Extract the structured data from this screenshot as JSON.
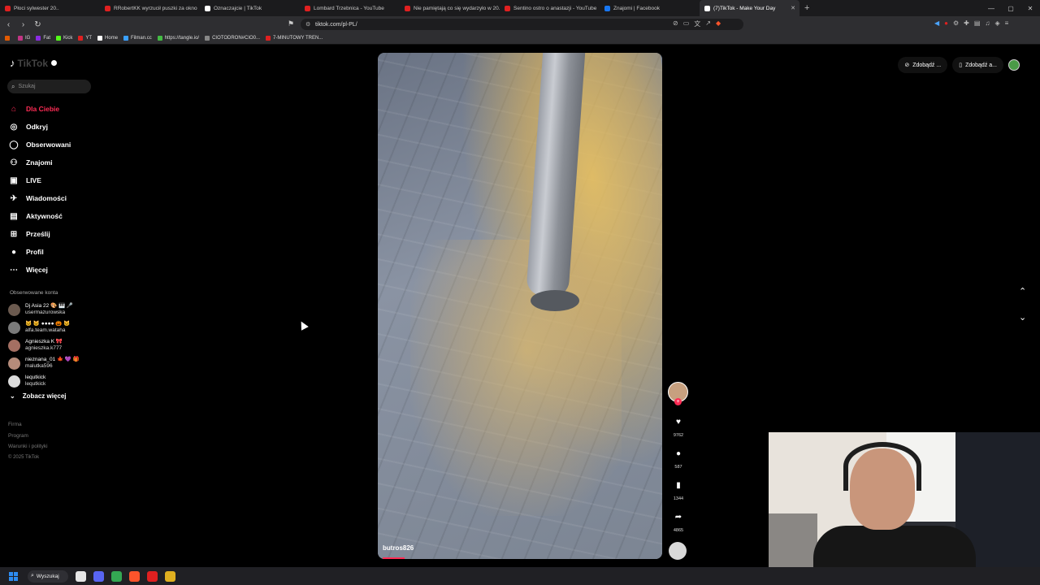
{
  "browser": {
    "tabs": [
      {
        "title": "Płoci sylwester 20..",
        "favicon_color": "#e02020",
        "active": false
      },
      {
        "title": "RRobertKK wyrzucił puszki za okno",
        "favicon_color": "#e02020",
        "active": false
      },
      {
        "title": "Oznaczajcie | TikTok",
        "favicon_color": "#ffffff",
        "active": false
      },
      {
        "title": "Lombard Trzebnica - YouTube",
        "favicon_color": "#e02020",
        "active": false
      },
      {
        "title": "Nie pamiętają co się wydarzyło w 20..",
        "favicon_color": "#e02020",
        "active": false
      },
      {
        "title": "Sentino ostro o anastazji - YouTube",
        "favicon_color": "#e02020",
        "active": false
      },
      {
        "title": "Znajomi | Facebook",
        "favicon_color": "#1877f2",
        "active": false
      },
      {
        "title": "(7)TikTok - Make Your Day",
        "favicon_color": "#ffffff",
        "active": true
      }
    ],
    "close_glyph": "✕",
    "new_tab_glyph": "+",
    "window_controls": [
      "—",
      "▢",
      "✕"
    ],
    "nav_glyphs": {
      "back": "‹",
      "forward": "›",
      "reload": "↻"
    },
    "url": "tiktok.com/pl-PL/",
    "bookmarks": [
      {
        "label": "",
        "color": "#e25a00"
      },
      {
        "label": "IG",
        "color": "#c13584"
      },
      {
        "label": "Fat",
        "color": "#8a2be2"
      },
      {
        "label": "Kick",
        "color": "#53fc18"
      },
      {
        "label": "YT",
        "color": "#e02020"
      },
      {
        "label": "Home",
        "color": "#ffffff"
      },
      {
        "label": "Filman.cc",
        "color": "#3aa0ff"
      },
      {
        "label": "https://tangle.io/",
        "color": "#44bb44"
      },
      {
        "label": "CIOTODRON#CIO0...",
        "color": "#888888"
      },
      {
        "label": "7-MINUTOWY TREN...",
        "color": "#e02020"
      }
    ]
  },
  "sidebar": {
    "logo_text": "TikTok",
    "search_placeholder": "Szukaj",
    "nav_items": [
      {
        "label": "Dla Ciebie",
        "icon": "home-icon",
        "glyph": "⌂",
        "active": true,
        "badge": false
      },
      {
        "label": "Odkryj",
        "icon": "compass-icon",
        "glyph": "◎",
        "active": false,
        "badge": false
      },
      {
        "label": "Obserwowani",
        "icon": "following-icon",
        "glyph": "◯",
        "active": false,
        "badge": false
      },
      {
        "label": "Znajomi",
        "icon": "friends-icon",
        "glyph": "⚇",
        "active": false,
        "badge": false
      },
      {
        "label": "LIVE",
        "icon": "live-icon",
        "glyph": "▣",
        "active": false,
        "badge": false
      },
      {
        "label": "Wiadomości",
        "icon": "messages-icon",
        "glyph": "✈",
        "active": false,
        "badge": true
      },
      {
        "label": "Aktywność",
        "icon": "activity-icon",
        "glyph": "▤",
        "active": false,
        "badge": true
      },
      {
        "label": "Prześlij",
        "icon": "upload-icon",
        "glyph": "⊞",
        "active": false,
        "badge": false
      },
      {
        "label": "Profil",
        "icon": "profile-icon",
        "glyph": "●",
        "active": false,
        "badge": false
      },
      {
        "label": "Więcej",
        "icon": "more-icon",
        "glyph": "⋯",
        "active": false,
        "badge": false
      }
    ],
    "followed_title": "Obserwowane konta",
    "followed_accounts": [
      {
        "name": "Dj Asia 22 🎨 🎹 🎤",
        "handle": "usermazurowska",
        "avatar_color": "#6b5a4f"
      },
      {
        "name": "🐱 🐱 ●●●● 🎃 🐱",
        "handle": "alfa.team.wataha",
        "avatar_color": "#7a7a7a"
      },
      {
        "name": "Agnieszka K 🎀",
        "handle": "agnieszka.k777",
        "avatar_color": "#a46f62"
      },
      {
        "name": "nieznana_01 🍁 💜 🎁",
        "handle": "malutka596",
        "avatar_color": "#b58b7a"
      },
      {
        "name": "lequtkick",
        "handle": "lequtkick",
        "avatar_color": "#dcdcdc"
      }
    ],
    "see_more": "Zobacz więcej",
    "footer": {
      "links": [
        "Firma",
        "Program",
        "Warunki i polityki"
      ],
      "copyright": "© 2025 TikTok"
    }
  },
  "video": {
    "author": "butros826",
    "progress": 0.08,
    "actions": [
      {
        "icon": "heart-icon",
        "glyph": "♥",
        "count": "9762"
      },
      {
        "icon": "comment-icon",
        "glyph": "●",
        "count": "587"
      },
      {
        "icon": "bookmark-icon",
        "glyph": "▮",
        "count": "1344"
      },
      {
        "icon": "share-icon",
        "glyph": "➦",
        "count": "4865"
      }
    ]
  },
  "topbar": {
    "get_coins": "Zdobądź ...",
    "get_app": "Zdobądź a..."
  },
  "taskbar": {
    "search_label": "Wyszukaj",
    "apps": [
      {
        "icon": "file-explorer-icon",
        "color": "#e6e6e6"
      },
      {
        "icon": "discord-icon",
        "color": "#5865f2"
      },
      {
        "icon": "chrome-icon",
        "color": "#34a853"
      },
      {
        "icon": "brave-icon",
        "color": "#fb542b"
      },
      {
        "icon": "opera-icon",
        "color": "#e02020"
      },
      {
        "icon": "app-icon",
        "color": "#e0b020"
      }
    ]
  },
  "colors": {
    "accent": "#fe2c55",
    "background": "#000000"
  }
}
